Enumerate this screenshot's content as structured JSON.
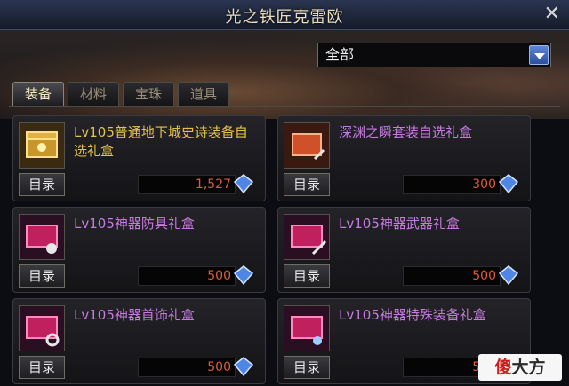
{
  "window": {
    "title": "光之铁匠克雷欧"
  },
  "filter": {
    "selected": "全部"
  },
  "tabs": [
    {
      "label": "装备",
      "active": true
    },
    {
      "label": "材料",
      "active": false
    },
    {
      "label": "宝珠",
      "active": false
    },
    {
      "label": "道具",
      "active": false
    }
  ],
  "items": [
    {
      "name": "Lv105普通地下城史诗装备自选礼盒",
      "price": "1,527",
      "catalog": "目录",
      "color": "#e6c24a",
      "icon": "epic-chest-icon"
    },
    {
      "name": "深渊之瞬套装自选礼盒",
      "price": "300",
      "catalog": "目录",
      "color": "#c77be0",
      "icon": "abyss-box-icon"
    },
    {
      "name": "Lv105神器防具礼盒",
      "price": "500",
      "catalog": "目录",
      "color": "#c77be0",
      "icon": "artifact-armor-box-icon"
    },
    {
      "name": "Lv105神器武器礼盒",
      "price": "500",
      "catalog": "目录",
      "color": "#c77be0",
      "icon": "artifact-weapon-box-icon"
    },
    {
      "name": "Lv105神器首饰礼盒",
      "price": "500",
      "catalog": "目录",
      "color": "#c77be0",
      "icon": "artifact-accessory-box-icon"
    },
    {
      "name": "Lv105神器特殊装备礼盒",
      "price": "500",
      "catalog": "目录",
      "color": "#c77be0",
      "icon": "artifact-special-box-icon"
    }
  ],
  "watermark": {
    "part1": "傻",
    "part2": "大方"
  }
}
